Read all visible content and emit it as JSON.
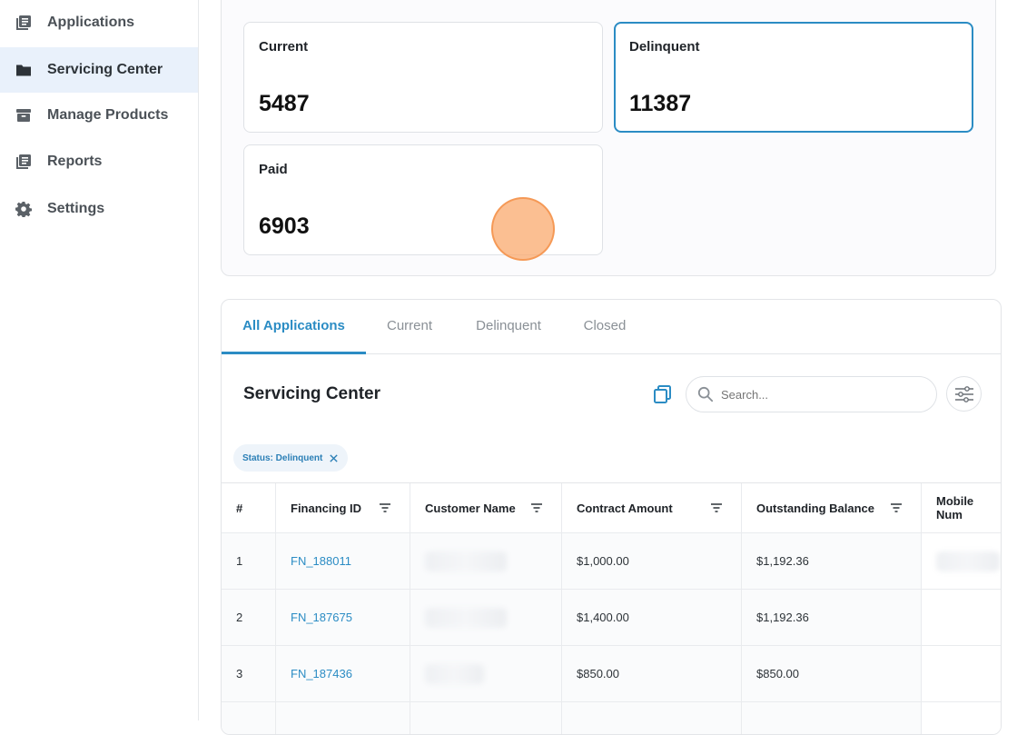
{
  "sidebar": {
    "items": [
      {
        "label": "Applications",
        "icon": "document-stack-icon",
        "active": false
      },
      {
        "label": "Servicing Center",
        "icon": "folder-icon",
        "active": true
      },
      {
        "label": "Manage Products",
        "icon": "archive-icon",
        "active": false
      },
      {
        "label": "Reports",
        "icon": "document-stack-icon",
        "active": false
      },
      {
        "label": "Settings",
        "icon": "gear-icon",
        "active": false
      }
    ]
  },
  "stats": {
    "current": {
      "label": "Current",
      "value": "5487"
    },
    "delinquent": {
      "label": "Delinquent",
      "value": "11387"
    },
    "paid": {
      "label": "Paid",
      "value": "6903"
    }
  },
  "tabs": [
    {
      "label": "All Applications",
      "active": true
    },
    {
      "label": "Current",
      "active": false
    },
    {
      "label": "Delinquent",
      "active": false
    },
    {
      "label": "Closed",
      "active": false
    }
  ],
  "section": {
    "title": "Servicing Center",
    "search_placeholder": "Search...",
    "filter_chip": "Status: Delinquent"
  },
  "table": {
    "headers": [
      "#",
      "Financing ID",
      "Customer Name",
      "Contract Amount",
      "Outstanding Balance",
      "Mobile Num"
    ],
    "rows": [
      {
        "index": "1",
        "financing_id": "FN_188011",
        "contract_amount": "$1,000.00",
        "outstanding_balance": "$1,192.36"
      },
      {
        "index": "2",
        "financing_id": "FN_187675",
        "contract_amount": "$1,400.00",
        "outstanding_balance": "$1,192.36"
      },
      {
        "index": "3",
        "financing_id": "FN_187436",
        "contract_amount": "$850.00",
        "outstanding_balance": "$850.00"
      }
    ]
  },
  "colors": {
    "accent": "#2b8cc4",
    "active_nav_bg": "#e9f1fb",
    "chip_bg": "#eef4fa"
  }
}
